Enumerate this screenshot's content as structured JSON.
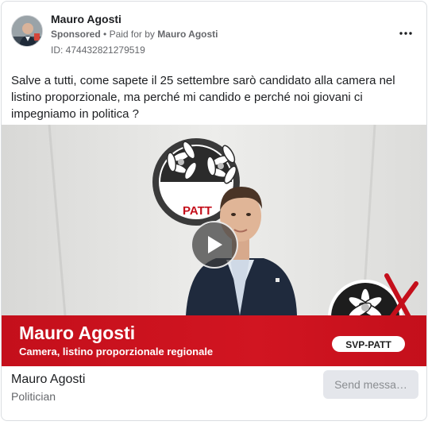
{
  "post": {
    "author": "Mauro Agosti",
    "sponsored_label": "Sponsored",
    "separator": "•",
    "paid_for_prefix": "Paid for by",
    "paid_for_name": "Mauro Agosti",
    "ad_id": "ID: 474432821279519",
    "more_icon": "more-horizontal-icon",
    "body_text": "Salve a tutti, come sapete il 25 settembre sarò candidato alla camera nel listino proporzionale, ma perché mi candido e perché noi giovani ci impegniamo in politica ?"
  },
  "media": {
    "logo_left_text": "PATT",
    "logo_right_text": "SVP-PATT",
    "banner_name": "Mauro Agosti",
    "banner_role": "Camera, listino proporzionale regionale",
    "play_icon": "play-icon",
    "banner_color": "#c40f1b"
  },
  "footer": {
    "page_name": "Mauro Agosti",
    "page_category": "Politician",
    "cta_label": "Send messa…"
  }
}
